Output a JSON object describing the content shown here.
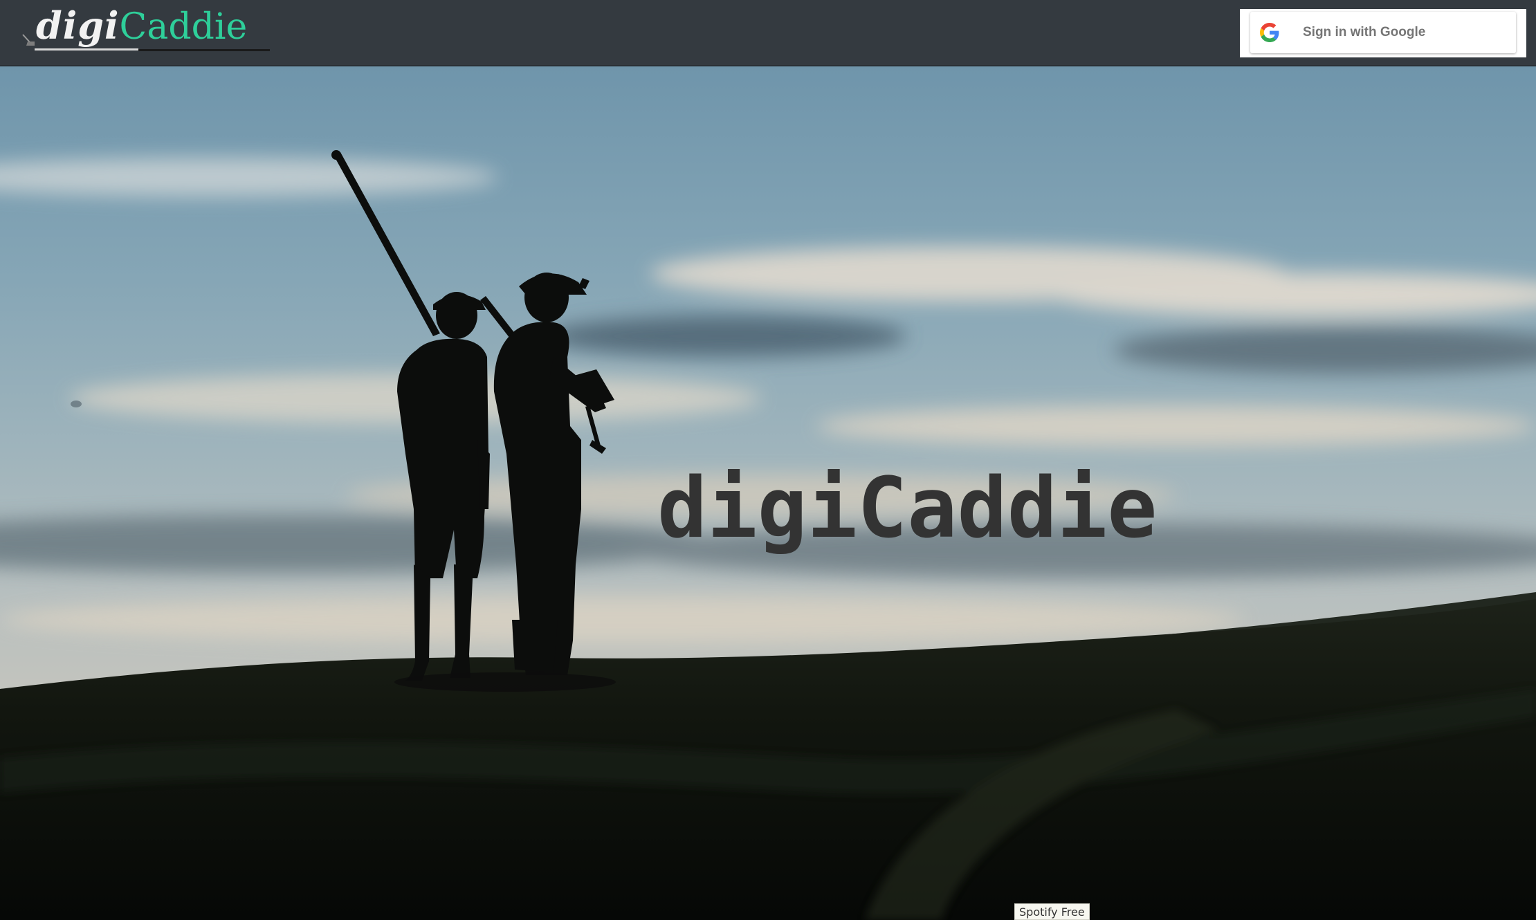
{
  "navbar": {
    "brand": {
      "prefix": "digi",
      "suffix": "Caddie",
      "logo_icon": "golf-club-icon"
    },
    "signin": {
      "label": "Sign in with Google",
      "icon": "google-g-icon"
    }
  },
  "hero": {
    "title": "digiCaddie",
    "background": "golfers-silhouette-at-dusk"
  },
  "footer": {
    "tag": "Spotify Free"
  },
  "colors": {
    "navbar_bg": "#343a40",
    "brand_accent": "#2ecf9a",
    "brand_light": "#f2f2f2",
    "hero_title": "#333333",
    "signin_text": "#757575"
  }
}
